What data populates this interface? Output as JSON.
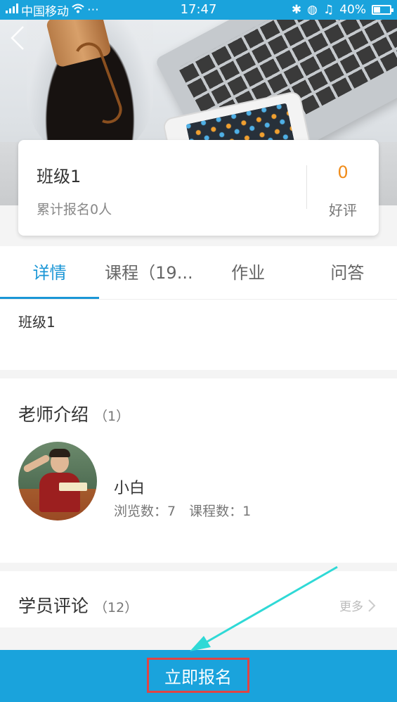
{
  "status_bar": {
    "carrier": "中国移动",
    "time": "17:47",
    "battery": "40%",
    "battery_level": 0.4
  },
  "class_info": {
    "name": "班级1",
    "enrolled": "累计报名0人",
    "rating_value": "0",
    "rating_label": "好评"
  },
  "tabs": [
    {
      "label": "详情",
      "active": true
    },
    {
      "label": "课程（19...",
      "active": false
    },
    {
      "label": "作业",
      "active": false
    },
    {
      "label": "问答",
      "active": false
    }
  ],
  "detail": {
    "text": "班级1"
  },
  "teachers": {
    "title": "老师介绍",
    "count": "（1）",
    "name": "小白",
    "stats": "浏览数：7　课程数：1"
  },
  "reviews": {
    "title": "学员评论",
    "count": "（12）",
    "more": "更多"
  },
  "action": {
    "signup_label": "立即报名"
  },
  "colors": {
    "accent": "#1aa3dc",
    "tab_active": "#1a96d6",
    "rating": "#f08c1a",
    "highlight": "#e04444",
    "annotation_arrow": "#2fd9d6"
  }
}
